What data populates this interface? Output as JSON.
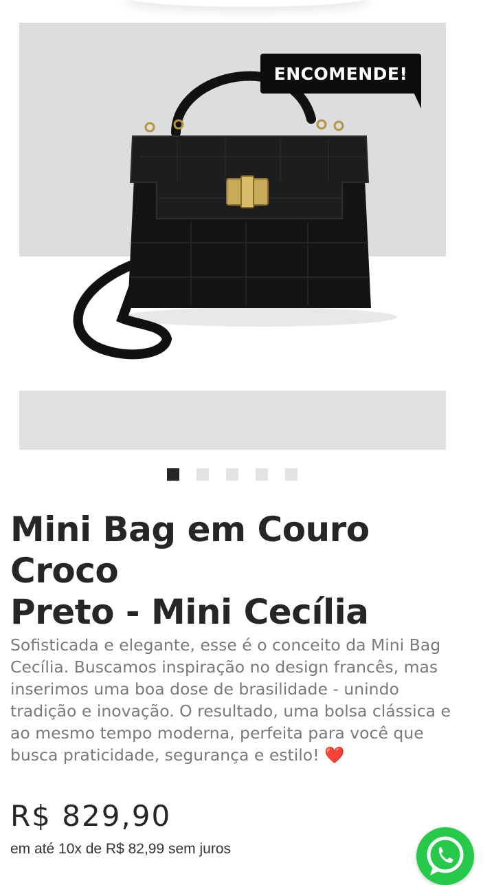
{
  "gallery": {
    "badge": "ENCOMENDE!",
    "dots": {
      "count": 5,
      "active_index": 0
    }
  },
  "product": {
    "title_line1": "Mini Bag em Couro Croco",
    "title_line2": "Preto - Mini Cecília",
    "description": "Sofisticada e elegante, esse é o conceito da Mini Bag Cecília. Buscamos inspiração no design francês, mas inserimos uma boa dose de brasilidade - unindo tradição e inovação. O resultado, uma bolsa clássica e ao mesmo tempo moderna, perfeita para você que busca praticidade, segurança e estilo!",
    "description_emoji": "❤️",
    "price": "R$ 829,90",
    "installments": "em até 10x de R$ 82,99 sem juros"
  },
  "floating": {
    "icon": "whatsapp-icon"
  },
  "colors": {
    "accent": "#26c94a",
    "badge_bg": "#0d0d0d",
    "text_dark": "#262626",
    "text_muted": "#7a7a7a"
  }
}
